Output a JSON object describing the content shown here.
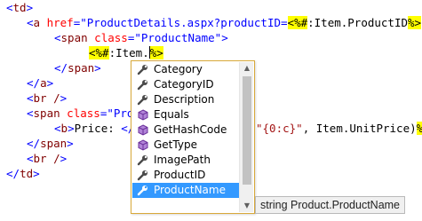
{
  "editor": {
    "line1_td_open": "td",
    "line2_a": "a",
    "line2_href_attr": "href",
    "line2_href_value": "ProductDetails.aspx?productID=",
    "line2_expr_open": "<%#",
    "line2_expr_body": ":Item.ProductID",
    "line2_expr_close": "%>",
    "line3_span": "span",
    "line3_class_attr": "class",
    "line3_class_value": "\"ProductName\"",
    "line4_expr_open": "<%#",
    "line4_expr_body": ":Item.",
    "line4_expr_close": "%>",
    "line5_span_close": "span",
    "line6_a_close": "a",
    "line7_br": "br /",
    "line8_span": "span",
    "line8_class_attr": "class",
    "line8_class_value": "\"Prod",
    "line9_b": "b",
    "line9_text": "Price: ",
    "line9_b_close_partial": "</b",
    "line9_format": "\"{0:c}\"",
    "line9_rest": ", Item.UnitPrice)",
    "line9_expr_close": "%>",
    "line10_span_close": "span",
    "line11_br": "br /",
    "line12_td_close": "td"
  },
  "completion": {
    "items": [
      {
        "label": "Category",
        "icon": "property-icon"
      },
      {
        "label": "CategoryID",
        "icon": "property-icon"
      },
      {
        "label": "Description",
        "icon": "property-icon"
      },
      {
        "label": "Equals",
        "icon": "method-icon"
      },
      {
        "label": "GetHashCode",
        "icon": "method-icon"
      },
      {
        "label": "GetType",
        "icon": "method-icon"
      },
      {
        "label": "ImagePath",
        "icon": "property-icon"
      },
      {
        "label": "ProductID",
        "icon": "property-icon"
      },
      {
        "label": "ProductName",
        "icon": "property-icon",
        "selected": true
      }
    ],
    "tooltip": "string Product.ProductName"
  },
  "colors": {
    "selection": "#3399ff",
    "delimiter_highlight": "#ffff00",
    "method_icon": "#9b59b6",
    "popup_border": "#d9a93a"
  }
}
